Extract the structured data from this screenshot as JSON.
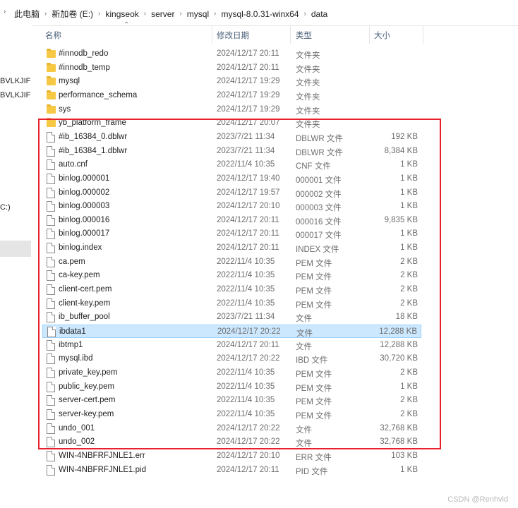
{
  "breadcrumb": [
    "此电脑",
    "新加卷 (E:)",
    "kingseok",
    "server",
    "mysql",
    "mysql-8.0.31-winx64",
    "data"
  ],
  "nav_pane": {
    "items": [
      "BVLKJIF",
      "BVLKJIF",
      "C:)"
    ]
  },
  "columns": {
    "name": "名称",
    "date": "修改日期",
    "type": "类型",
    "size": "大小"
  },
  "files": [
    {
      "name": "#innodb_redo",
      "date": "2024/12/17 20:11",
      "type": "文件夹",
      "size": "",
      "kind": "folder"
    },
    {
      "name": "#innodb_temp",
      "date": "2024/12/17 20:11",
      "type": "文件夹",
      "size": "",
      "kind": "folder"
    },
    {
      "name": "mysql",
      "date": "2024/12/17 19:29",
      "type": "文件夹",
      "size": "",
      "kind": "folder"
    },
    {
      "name": "performance_schema",
      "date": "2024/12/17 19:29",
      "type": "文件夹",
      "size": "",
      "kind": "folder"
    },
    {
      "name": "sys",
      "date": "2024/12/17 19:29",
      "type": "文件夹",
      "size": "",
      "kind": "folder"
    },
    {
      "name": "yb_platform_frame",
      "date": "2024/12/17 20:07",
      "type": "文件夹",
      "size": "",
      "kind": "folder"
    },
    {
      "name": "#ib_16384_0.dblwr",
      "date": "2023/7/21 11:34",
      "type": "DBLWR 文件",
      "size": "192 KB",
      "kind": "file"
    },
    {
      "name": "#ib_16384_1.dblwr",
      "date": "2023/7/21 11:34",
      "type": "DBLWR 文件",
      "size": "8,384 KB",
      "kind": "file"
    },
    {
      "name": "auto.cnf",
      "date": "2022/11/4 10:35",
      "type": "CNF 文件",
      "size": "1 KB",
      "kind": "file"
    },
    {
      "name": "binlog.000001",
      "date": "2024/12/17 19:40",
      "type": "000001 文件",
      "size": "1 KB",
      "kind": "file"
    },
    {
      "name": "binlog.000002",
      "date": "2024/12/17 19:57",
      "type": "000002 文件",
      "size": "1 KB",
      "kind": "file"
    },
    {
      "name": "binlog.000003",
      "date": "2024/12/17 20:10",
      "type": "000003 文件",
      "size": "1 KB",
      "kind": "file"
    },
    {
      "name": "binlog.000016",
      "date": "2024/12/17 20:11",
      "type": "000016 文件",
      "size": "9,835 KB",
      "kind": "file"
    },
    {
      "name": "binlog.000017",
      "date": "2024/12/17 20:11",
      "type": "000017 文件",
      "size": "1 KB",
      "kind": "file"
    },
    {
      "name": "binlog.index",
      "date": "2024/12/17 20:11",
      "type": "INDEX 文件",
      "size": "1 KB",
      "kind": "file"
    },
    {
      "name": "ca.pem",
      "date": "2022/11/4 10:35",
      "type": "PEM 文件",
      "size": "2 KB",
      "kind": "file"
    },
    {
      "name": "ca-key.pem",
      "date": "2022/11/4 10:35",
      "type": "PEM 文件",
      "size": "2 KB",
      "kind": "file"
    },
    {
      "name": "client-cert.pem",
      "date": "2022/11/4 10:35",
      "type": "PEM 文件",
      "size": "2 KB",
      "kind": "file"
    },
    {
      "name": "client-key.pem",
      "date": "2022/11/4 10:35",
      "type": "PEM 文件",
      "size": "2 KB",
      "kind": "file"
    },
    {
      "name": "ib_buffer_pool",
      "date": "2023/7/21 11:34",
      "type": "文件",
      "size": "18 KB",
      "kind": "file"
    },
    {
      "name": "ibdata1",
      "date": "2024/12/17 20:22",
      "type": "文件",
      "size": "12,288 KB",
      "kind": "file",
      "selected": true
    },
    {
      "name": "ibtmp1",
      "date": "2024/12/17 20:11",
      "type": "文件",
      "size": "12,288 KB",
      "kind": "file"
    },
    {
      "name": "mysql.ibd",
      "date": "2024/12/17 20:22",
      "type": "IBD 文件",
      "size": "30,720 KB",
      "kind": "file"
    },
    {
      "name": "private_key.pem",
      "date": "2022/11/4 10:35",
      "type": "PEM 文件",
      "size": "2 KB",
      "kind": "file"
    },
    {
      "name": "public_key.pem",
      "date": "2022/11/4 10:35",
      "type": "PEM 文件",
      "size": "1 KB",
      "kind": "file"
    },
    {
      "name": "server-cert.pem",
      "date": "2022/11/4 10:35",
      "type": "PEM 文件",
      "size": "2 KB",
      "kind": "file"
    },
    {
      "name": "server-key.pem",
      "date": "2022/11/4 10:35",
      "type": "PEM 文件",
      "size": "2 KB",
      "kind": "file"
    },
    {
      "name": "undo_001",
      "date": "2024/12/17 20:22",
      "type": "文件",
      "size": "32,768 KB",
      "kind": "file"
    },
    {
      "name": "undo_002",
      "date": "2024/12/17 20:22",
      "type": "文件",
      "size": "32,768 KB",
      "kind": "file"
    },
    {
      "name": "WIN-4NBFRFJNLE1.err",
      "date": "2024/12/17 20:10",
      "type": "ERR 文件",
      "size": "103 KB",
      "kind": "file"
    },
    {
      "name": "WIN-4NBFRFJNLE1.pid",
      "date": "2024/12/17 20:11",
      "type": "PID 文件",
      "size": "1 KB",
      "kind": "file"
    }
  ],
  "colors": {
    "selection": "#cce8ff",
    "selection_border": "#99d1ff",
    "highlight_box": "#e8212c",
    "folder": "#f7c844"
  },
  "watermark": "CSDN @Renhvid"
}
